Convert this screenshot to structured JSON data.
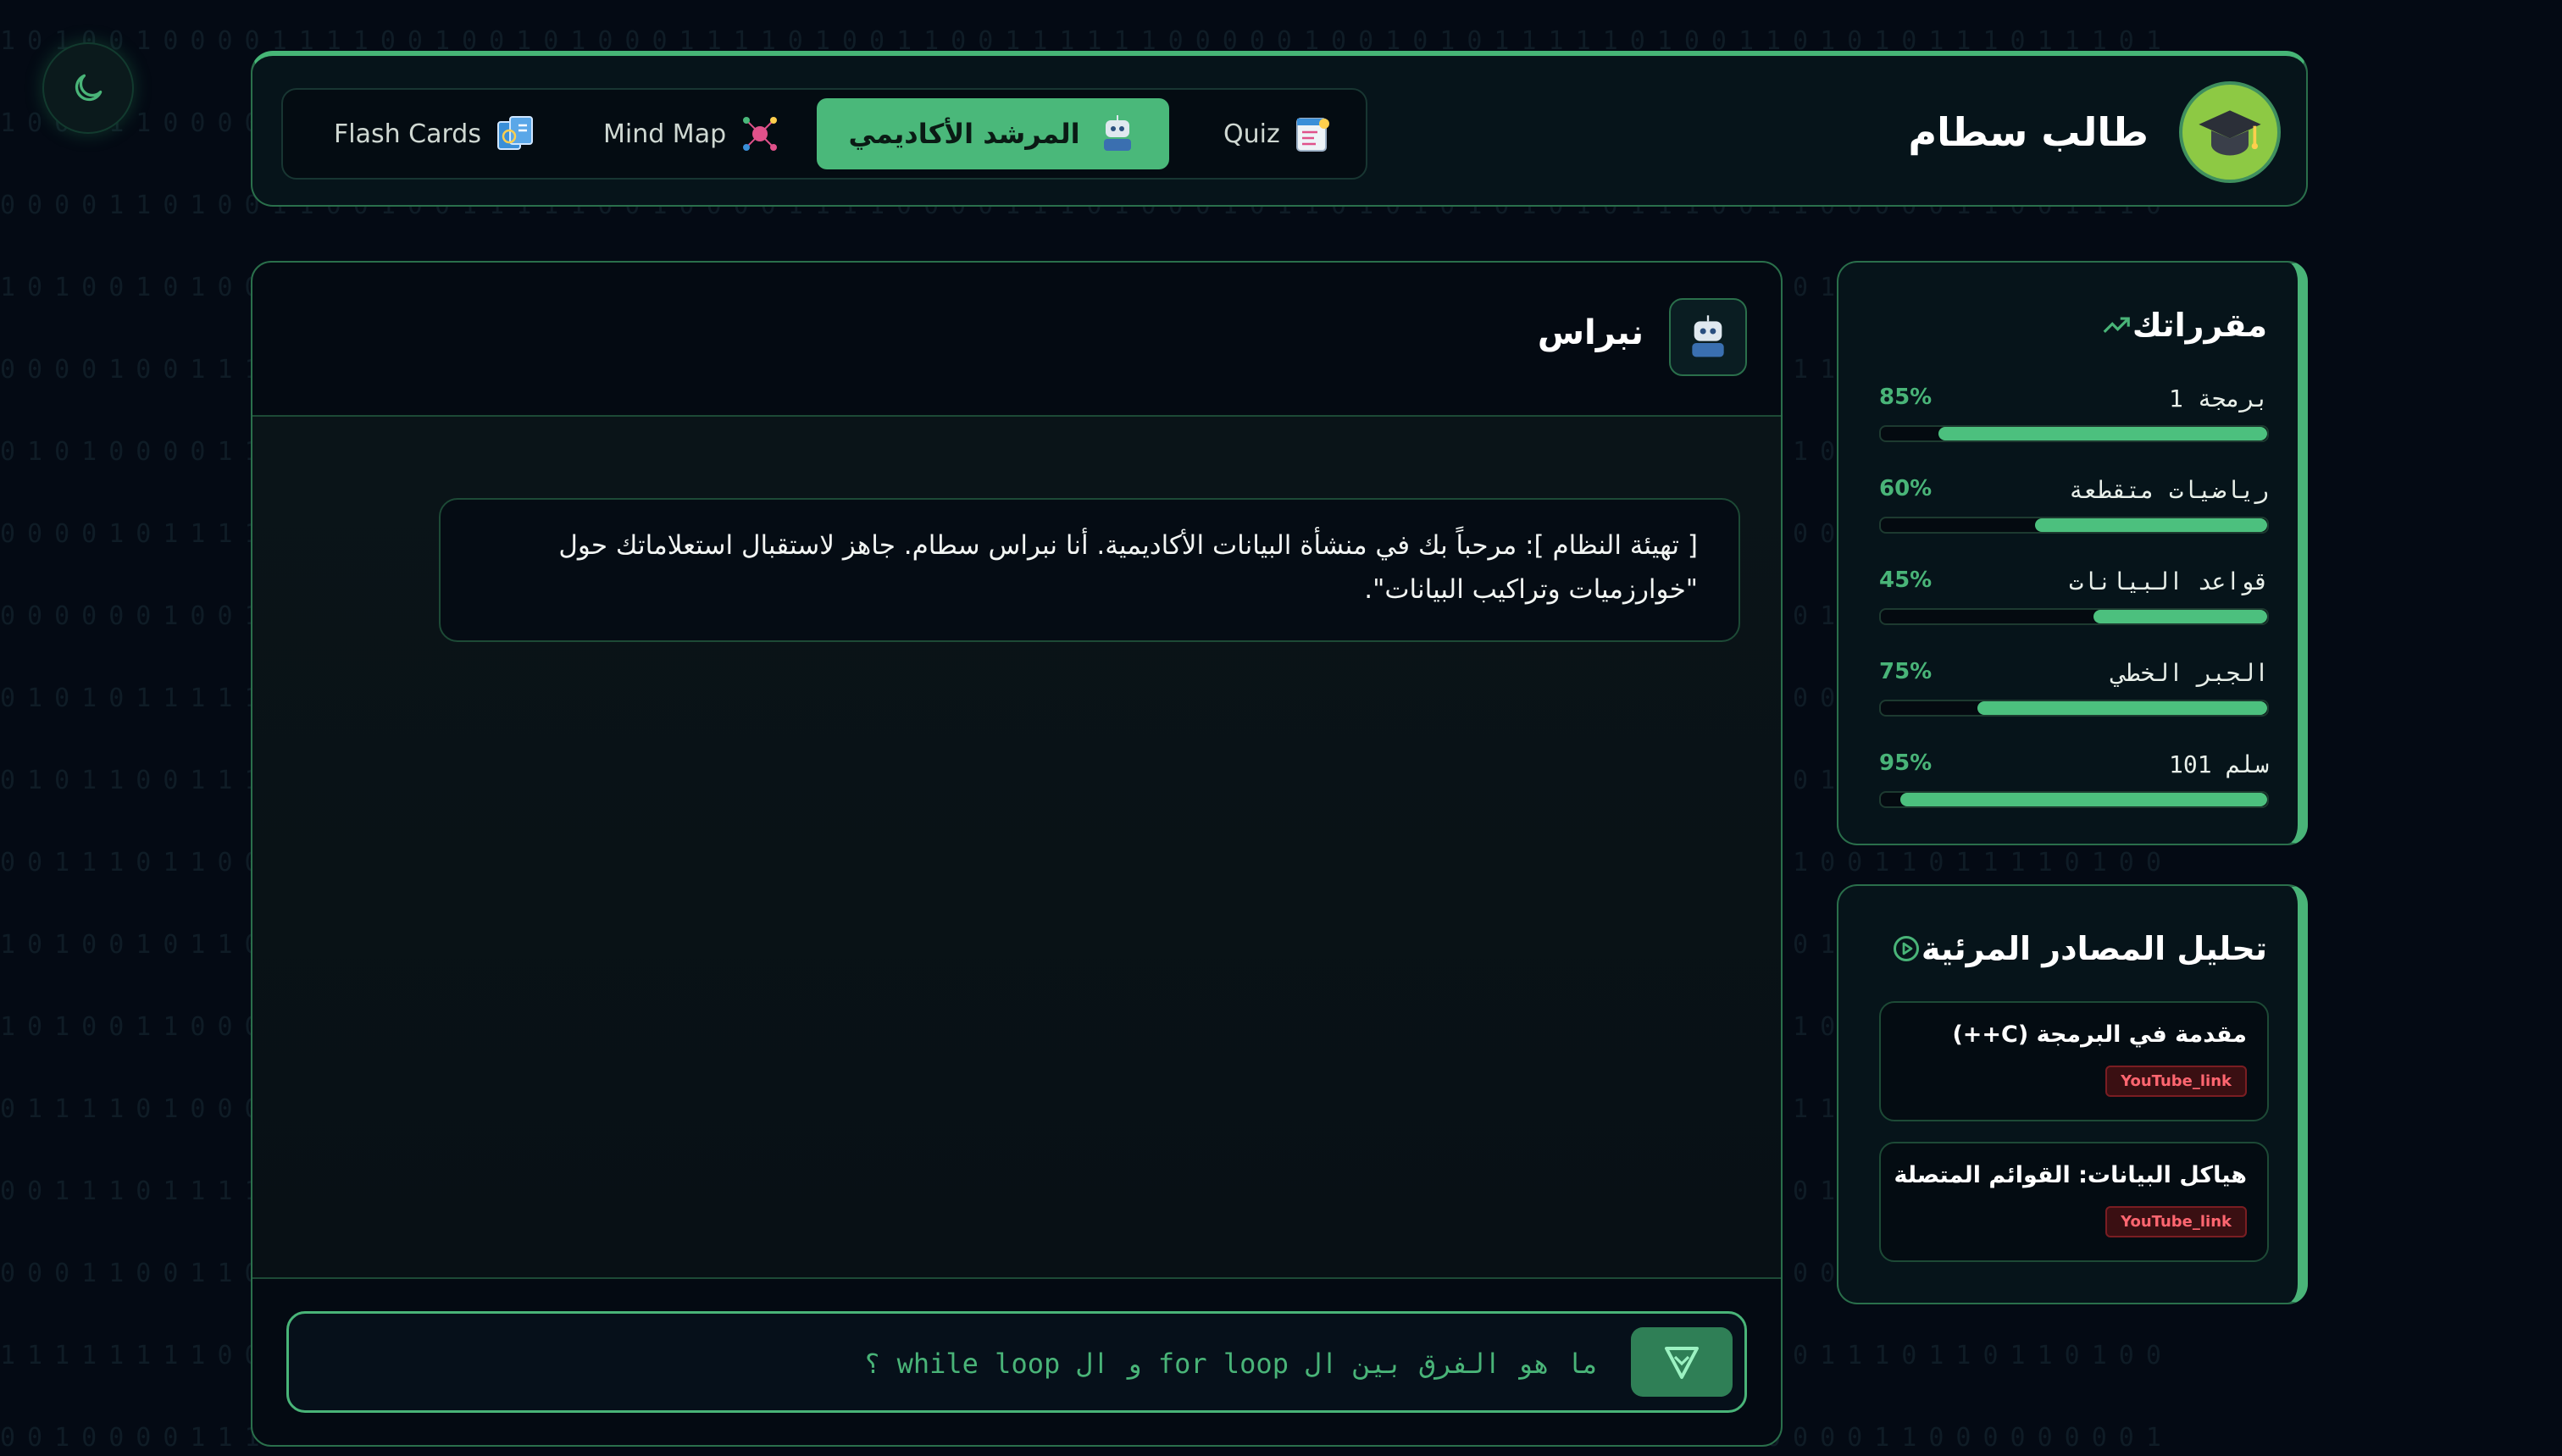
{
  "theme": {
    "accent": "#49b478",
    "background": "#040a14",
    "panel_border": "#2a6f4b",
    "badge_red": "#ff6670"
  },
  "theme_toggle": {
    "icon": "moon-icon"
  },
  "header": {
    "student_name": "طالب سطام",
    "avatar_icon": "graduation-cap-icon",
    "tabs": [
      {
        "label": "Flash Cards",
        "icon": "flash-cards-icon",
        "active": false
      },
      {
        "label": "Mind Map",
        "icon": "mind-map-icon",
        "active": false
      },
      {
        "label": "المرشد الأكاديمي",
        "icon": "robot-icon",
        "active": true
      },
      {
        "label": "Quiz",
        "icon": "quiz-icon",
        "active": false
      }
    ]
  },
  "chat": {
    "bot_name": "نبراس",
    "bot_icon": "robot-icon",
    "messages": [
      {
        "text": "[ تهيئة النظام ]: مرحباً بك في منشأة البيانات الأكاديمية. أنا نبراس سطام. جاهز لاستقبال استعلاماتك حول \"خوارزميات وتراكيب البيانات\"."
      }
    ],
    "input_value": "ما هو الفرق بين ال for loop و ال while loop ؟",
    "send_icon": "send-icon"
  },
  "courses": {
    "title": "مقرراتك",
    "icon": "trending-up-icon",
    "items": [
      {
        "name": "برمجة 1",
        "percent_label": "85%",
        "progress": 85
      },
      {
        "name": "رياضيات متقطعة",
        "percent_label": "60%",
        "progress": 60
      },
      {
        "name": "قواعد البيانات",
        "percent_label": "45%",
        "progress": 45
      },
      {
        "name": "الجبر الخطي",
        "percent_label": "75%",
        "progress": 75
      },
      {
        "name": "سلم 101",
        "percent_label": "95%",
        "progress": 95
      }
    ]
  },
  "sources": {
    "title": "تحليل المصادر المرئية",
    "icon": "play-circle-icon",
    "items": [
      {
        "title": "مقدمة في البرمجة (C++)",
        "badge": "YouTube_link"
      },
      {
        "title": "هياكل البيانات: القوائم المتصلة",
        "badge": "YouTube_link"
      }
    ]
  }
}
